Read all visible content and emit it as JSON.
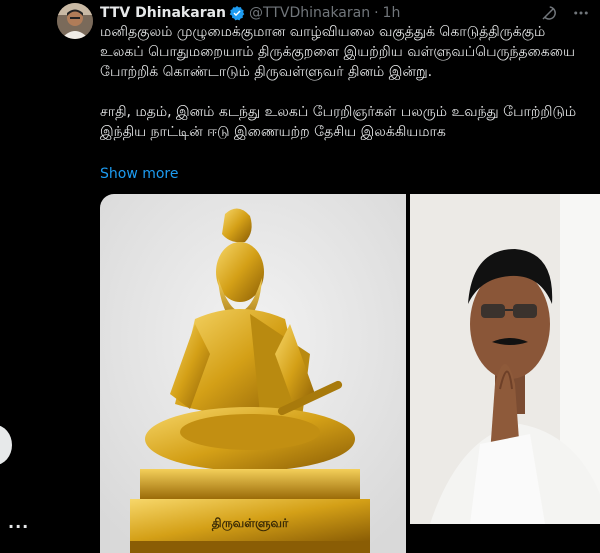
{
  "tweet": {
    "author_name": "TTV Dhinakaran",
    "handle": "@TTVDhinakaran",
    "separator": "·",
    "time": "1h",
    "paragraphs": [
      "மனிதகுலம் முழுமைக்குமான வாழ்வியலை வகுத்துக் கொடுத்திருக்கும் உலகப் பொதுமறையாம் திருக்குறளை இயற்றிய வள்ளுவப்பெருந்தகையை போற்றிக் கொண்டாடும் திருவள்ளுவர் தினம் இன்று.",
      "சாதி, மதம், இனம் கடந்து உலகப் பேரறிஞர்கள் பலரும் உவந்து போற்றிடும் இந்திய நாட்டின் ஈடு இணையற்ற தேசிய இலக்கியமாக"
    ],
    "show_more": "Show more",
    "statue_plaque": "திருவள்ளுவர்"
  },
  "left_rail": {
    "more_label": "···"
  },
  "colors": {
    "link": "#1d9bf0",
    "verified": "#1d9bf0",
    "muted": "#71767b",
    "text": "#e7e9ea",
    "gold": "#d4a017"
  },
  "icons": [
    "verified-badge-icon",
    "grok-icon",
    "more-options-icon"
  ]
}
